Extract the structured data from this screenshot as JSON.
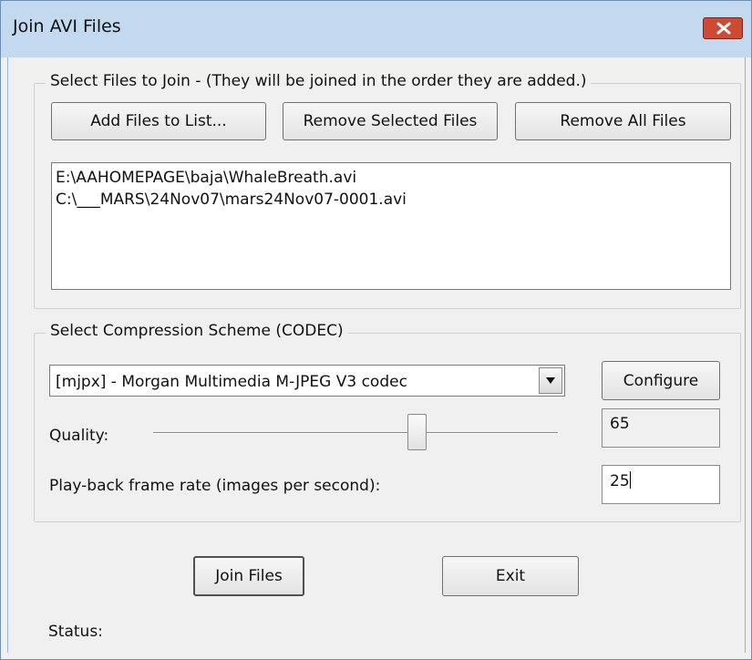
{
  "window": {
    "title": "Join AVI Files"
  },
  "files_group": {
    "legend": "Select Files to Join  -  (They will be joined in the order they are added.)",
    "add_label": "Add Files to List...",
    "remove_selected_label": "Remove Selected Files",
    "remove_all_label": "Remove All Files",
    "files": [
      "E:\\AAHOMEPAGE\\baja\\WhaleBreath.avi",
      "C:\\___MARS\\24Nov07\\mars24Nov07-0001.avi"
    ]
  },
  "codec_group": {
    "legend": "Select Compression Scheme (CODEC)",
    "codec_selected": "[mjpx] - Morgan Multimedia M-JPEG V3 codec",
    "configure_label": "Configure",
    "quality_label": "Quality:",
    "quality_value": "65",
    "quality_fraction": 0.65,
    "framerate_label": "Play-back frame rate (images per second):",
    "framerate_value": "25"
  },
  "actions": {
    "join_label": "Join Files",
    "exit_label": "Exit"
  },
  "status": {
    "label": "Status:",
    "text": ""
  },
  "colors": {
    "titlebar": "#c3d9f0",
    "close": "#cf4a34",
    "face": "#f0f0f0"
  },
  "icons": {
    "close": "close-x-icon",
    "dropdown": "chevron-down-icon"
  }
}
